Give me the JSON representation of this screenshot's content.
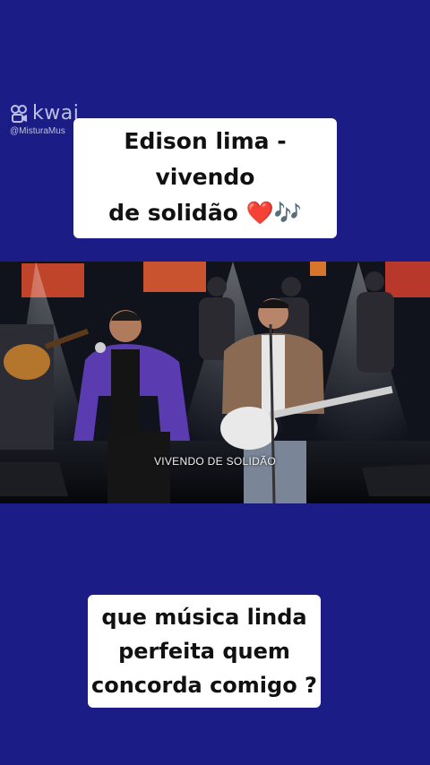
{
  "watermark": {
    "brand": "kwai",
    "handle": "@MisturaMus",
    "icon": "kwai-logo-icon"
  },
  "caption_top": {
    "line1": "Edison lima - vivendo",
    "line2": "de solidão ❤️🎶"
  },
  "video": {
    "subtitle": "VIVENDO DE SOLIDÃO"
  },
  "caption_bottom": {
    "line1": "que música linda",
    "line2": "perfeita quem",
    "line3": "concorda comigo ?"
  },
  "colors": {
    "background": "#1c1c86",
    "caption_bg": "#ffffff",
    "caption_text": "#111111"
  }
}
